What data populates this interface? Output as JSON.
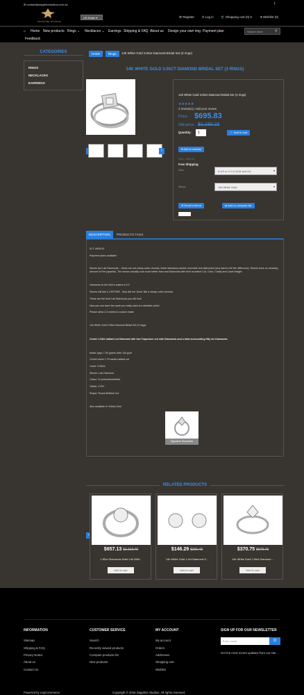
{
  "header": {
    "email": "contact@sapphirestudios.com.au",
    "logo_text": "SAPPHIRE STUDIOS",
    "currency": "US Dollar ▾",
    "links": [
      "Register",
      "Log in",
      "Shopping cart (0) ▾",
      "Wishlist (0)"
    ],
    "search_placeholder": "Search store"
  },
  "nav": {
    "items": [
      "Home",
      "New products",
      "Rings",
      "Necklaces",
      "Earrings",
      "Shipping & FAQ",
      "About us",
      "Design your own ring",
      "Payment plan"
    ],
    "sub": "Feedback"
  },
  "sidebar": {
    "title": "CATEGORIES",
    "items": [
      "RINGS",
      "NECKLACES",
      "EARRINGS"
    ]
  },
  "breadcrumb": {
    "home": "Home",
    "rings": "Rings",
    "current": "14k White Gold 3.05ct Diamond Bridal Set (3 rings)"
  },
  "product": {
    "title": "14K WHITE GOLD 3.05CT DIAMOND BRIDAL SET (3 RINGS)",
    "name": "14k White Gold 3.05ct Diamond Bridal Set (3 rings)",
    "stars": "★★★★★",
    "reviews": "2 review(s) | Add your review",
    "price_label": "Price:",
    "price": "$695.83",
    "old_price_label": "Old price:",
    "old_price": "$1,150.23",
    "qty_label": "Quantity:",
    "qty": "1",
    "add_to_cart": "Add to cart",
    "add_to_wishlist": "Add to wishlist",
    "sku": "SKU: V605-03",
    "shipping": "Free Shipping",
    "size_label": "Size:",
    "size_value": "6 US or H 1/2 AUS and UK",
    "metal_label": "Metal:",
    "metal_value": "14k White Gold",
    "email_friend": "Email a friend",
    "compare": "Add to compare list"
  },
  "tabs": [
    "DESCRIPTION",
    "PRODUCTS TAGS"
  ],
  "description": [
    "IS Z V605-03",
    "Payment plans available",
    "Stones are Lab Diamonds -- these are not cheap cubic zirconia, these laboratory stones resemble real diamonds (very hard to tell the difference). Stones have an amazing amount of Fire (sparkle). The stones actually look much better than real Diamonds with their excellent Cut, Color, Clarity and Carat Weight.",
    "Hardness on the Moh's scales is 9.2",
    "Stones will last a LIFETIME - they will not 'cloud' like a cheap cubic zirconia",
    "These are the best Lab Diamonds you will find!",
    "Now you can have the carat you really want at a fantastic price!",
    "Please allow 2-3 weeks to custom make",
    "14k White Gold 3.05ct Diamond Bridal Set (3 rings)",
    "Centre 1.05ct radiant cut Diamond with two Trapezium cut side Diamonds and a total surrounding fifty six Diamonds.",
    "Metal: Appx 7.50 grams solid 14k gold",
    "Centre stone 1.75 carats radiant cut",
    "Carat: 3.05cts",
    "Stones: Lab Diamond",
    "Colour: D (colourless/white)",
    "Clarity: VVS1",
    "Shape: Round Brilliant Cut",
    "Also available in Yellow Gold",
    "Signature Guarantee"
  ],
  "related": {
    "title": "RELATED PRODUCTS",
    "items": [
      {
        "price": "$657.13",
        "old": "$1,113.79",
        "name": "1.80ct Diamonds Solid 14k Whit..."
      },
      {
        "price": "$146.29",
        "old": "$231.43",
        "name": "14k White Gold 1.0ct Diamond S..."
      },
      {
        "price": "$370.75",
        "old": "$679.73",
        "name": "14k White Gold 2.00ct Diamond ..."
      }
    ],
    "btn": "Add to cart"
  },
  "footer": {
    "cols": [
      {
        "title": "INFORMATION",
        "links": [
          "Sitemap",
          "Shipping & FAQ",
          "Privacy Notice",
          "About us",
          "Contact Us"
        ]
      },
      {
        "title": "CUSTOMER SERVICE",
        "links": [
          "Search",
          "Recently viewed products",
          "Compare products list",
          "New products"
        ]
      },
      {
        "title": "MY ACCOUNT",
        "links": [
          "My account",
          "Orders",
          "Addresses",
          "Shopping cart",
          "Wishlist"
        ]
      }
    ],
    "newsletter_title": "SIGN UP FOR OUR NEWSLETTER",
    "newsletter_placeholder": "Enter email",
    "newsletter_text": "Get the most recent updates from our site...",
    "powered": "Powered by nopCommerce",
    "copyright": "Copyright © 2016 Sapphire Studios. All rights reserved."
  }
}
